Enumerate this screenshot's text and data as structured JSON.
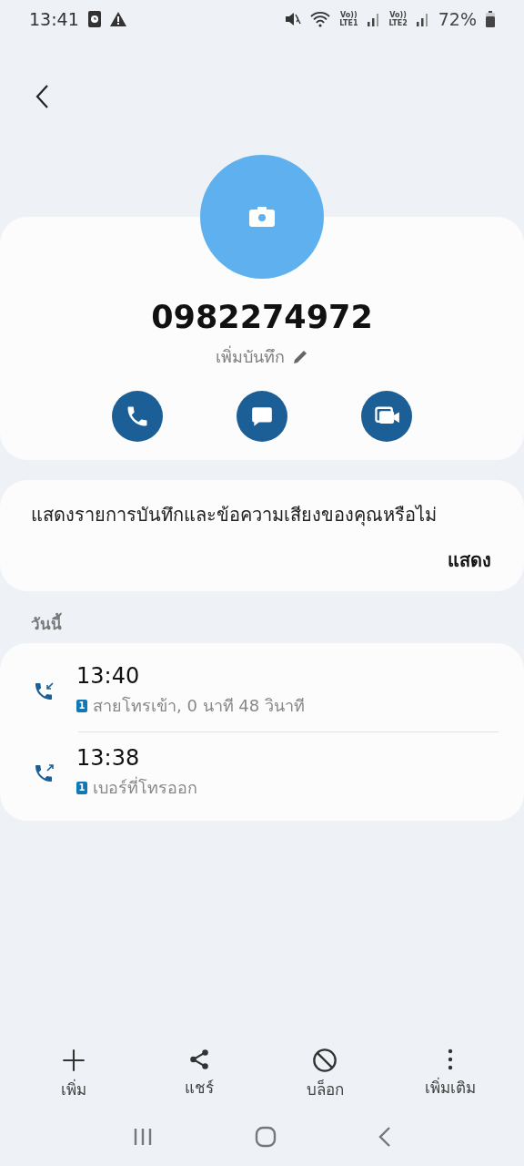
{
  "status_bar": {
    "time": "13:41",
    "sims": [
      {
        "top": "Vo))",
        "bottom": "LTE1"
      },
      {
        "top": "Vo))",
        "bottom": "LTE2"
      }
    ],
    "battery": "72%"
  },
  "contact": {
    "number": "0982274972",
    "note": "เพิ่มบันทึก"
  },
  "actions": [
    {
      "kind": "call"
    },
    {
      "kind": "message"
    },
    {
      "kind": "video"
    }
  ],
  "prompt": {
    "text": "แสดงรายการบันทึกและข้อความเสียงของคุณหรือไม่",
    "button": "แสดง"
  },
  "section": "วันนี้",
  "calls": [
    {
      "kind": "incoming",
      "time": "13:40",
      "sim": "1",
      "detail": "สายโทรเข้า, 0 นาที 48 วินาที"
    },
    {
      "kind": "outgoing",
      "time": "13:38",
      "sim": "1",
      "detail": "เบอร์ที่โทรออก"
    }
  ],
  "bottom_bar": [
    {
      "kind": "add",
      "label": "เพิ่ม"
    },
    {
      "kind": "share",
      "label": "แชร์"
    },
    {
      "kind": "block",
      "label": "บล็อก"
    },
    {
      "kind": "more",
      "label": "เพิ่มเติม"
    }
  ]
}
